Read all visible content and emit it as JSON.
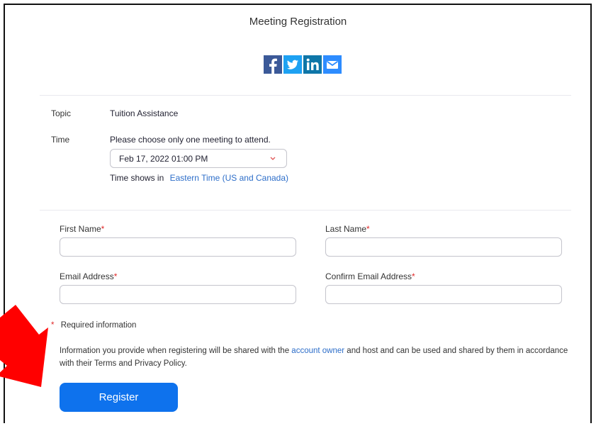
{
  "page": {
    "title": "Meeting Registration"
  },
  "share": {
    "icons": [
      "facebook-icon",
      "twitter-icon",
      "linkedin-icon",
      "email-icon"
    ]
  },
  "meeting": {
    "topic_label": "Topic",
    "topic_value": "Tuition Assistance",
    "time_label": "Time",
    "time_instruction": "Please choose only one meeting to attend.",
    "selected_time": "Feb 17, 2022 01:00 PM",
    "timezone_prefix": "Time shows in",
    "timezone": "Eastern Time (US and Canada)"
  },
  "form": {
    "first_name_label": "First Name",
    "last_name_label": "Last Name",
    "email_label": "Email Address",
    "confirm_email_label": "Confirm Email Address",
    "required_marker": "*",
    "first_name_value": "",
    "last_name_value": "",
    "email_value": "",
    "confirm_email_value": ""
  },
  "notice": {
    "required_text": "Required information",
    "privacy_pre": "Information you provide when registering will be shared with the",
    "privacy_link": "account owner",
    "privacy_post": "and host and can be used and shared by them in accordance with their Terms and Privacy Policy."
  },
  "actions": {
    "register_label": "Register"
  },
  "colors": {
    "accent": "#0e72ed",
    "link": "#2d6ec9",
    "required": "#e02828",
    "arrow": "#ff0000"
  }
}
